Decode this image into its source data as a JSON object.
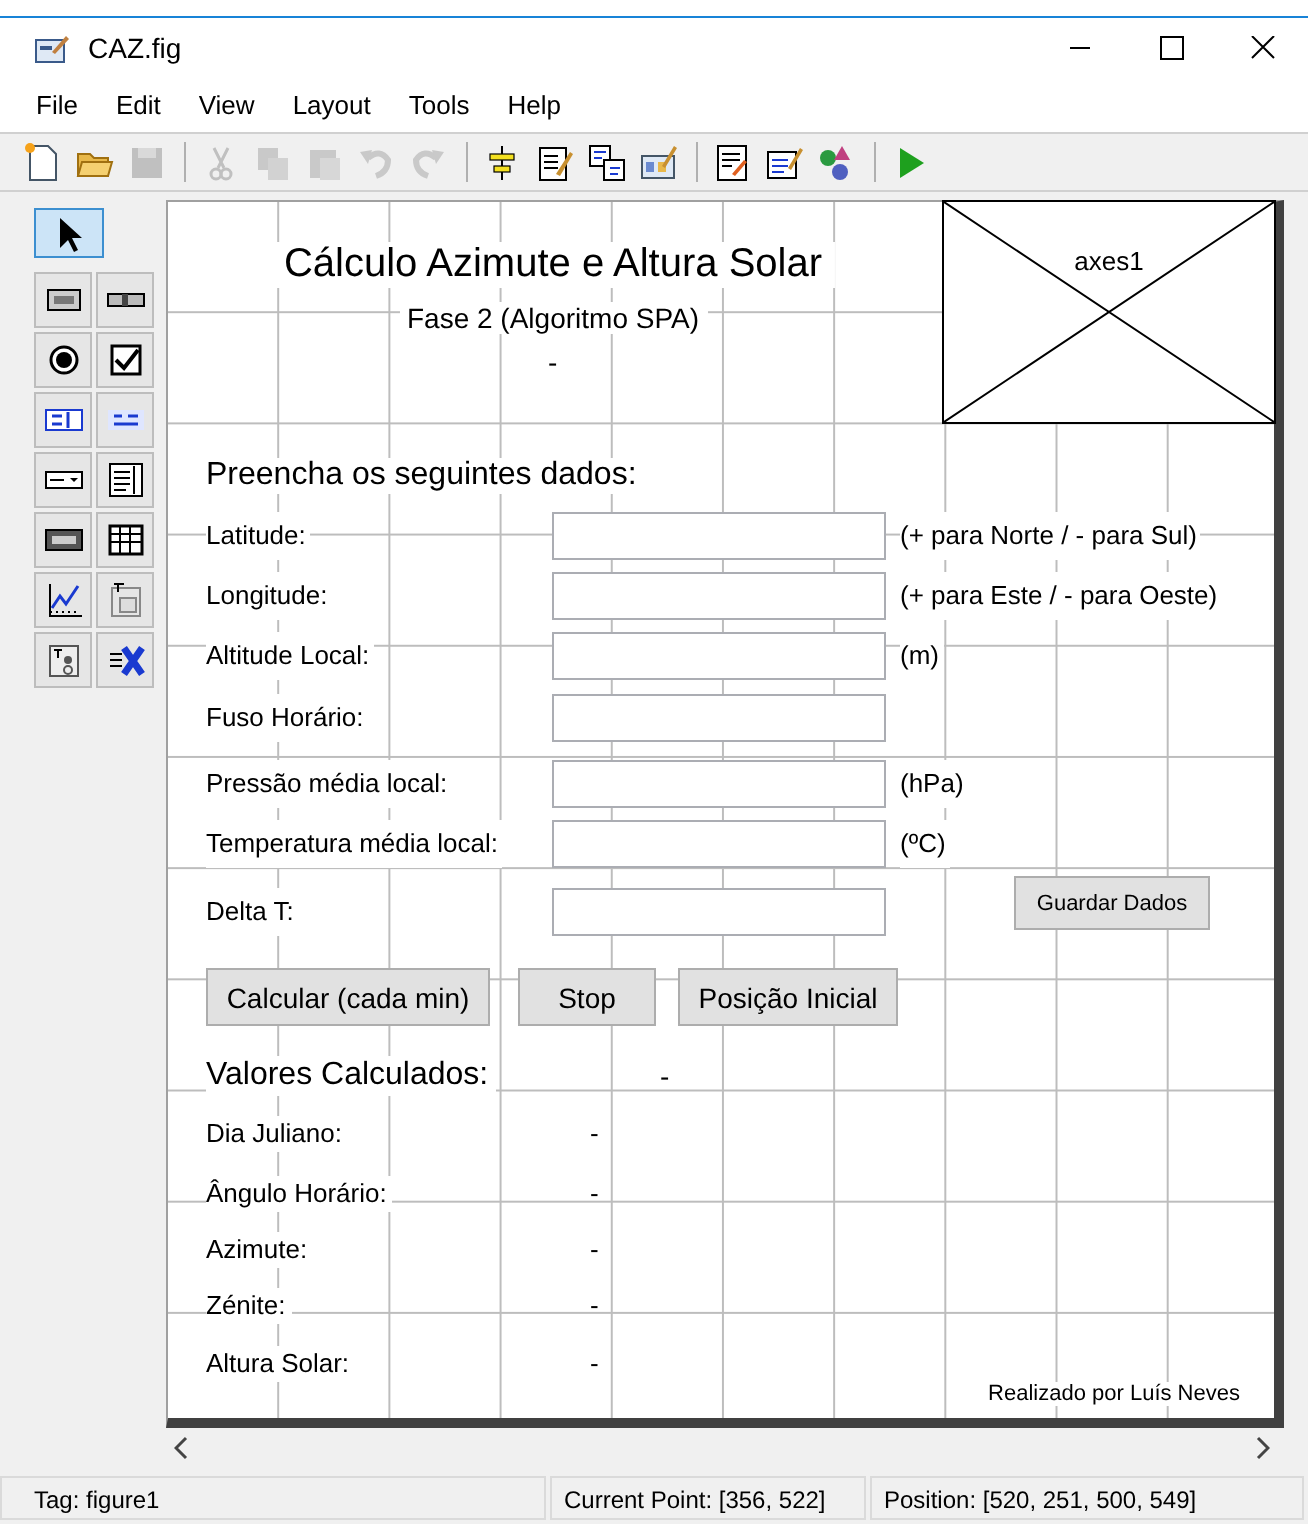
{
  "window": {
    "title": "CAZ.fig"
  },
  "menu": [
    "File",
    "Edit",
    "View",
    "Layout",
    "Tools",
    "Help"
  ],
  "toolbar": [
    {
      "kind": "new",
      "disabled": false
    },
    {
      "kind": "open",
      "disabled": false
    },
    {
      "kind": "save",
      "disabled": true
    },
    {
      "kind": "separator"
    },
    {
      "kind": "cut",
      "disabled": true
    },
    {
      "kind": "copy",
      "disabled": true
    },
    {
      "kind": "paste",
      "disabled": true
    },
    {
      "kind": "undo",
      "disabled": true
    },
    {
      "kind": "redo",
      "disabled": true
    },
    {
      "kind": "separator"
    },
    {
      "kind": "align",
      "disabled": false
    },
    {
      "kind": "menu-editor",
      "disabled": false
    },
    {
      "kind": "tab-order",
      "disabled": false
    },
    {
      "kind": "toolbar-editor",
      "disabled": false
    },
    {
      "kind": "separator"
    },
    {
      "kind": "editor",
      "disabled": false
    },
    {
      "kind": "inspector",
      "disabled": false
    },
    {
      "kind": "browser",
      "disabled": false
    },
    {
      "kind": "separator"
    },
    {
      "kind": "run",
      "disabled": false
    }
  ],
  "palette": [
    {
      "kind": "pointer",
      "selected": true
    },
    {
      "kind": "push-button",
      "selected": false
    },
    {
      "kind": "slider",
      "selected": false
    },
    {
      "kind": "radio",
      "selected": false
    },
    {
      "kind": "checkbox",
      "selected": false
    },
    {
      "kind": "edit",
      "selected": false
    },
    {
      "kind": "static",
      "selected": false
    },
    {
      "kind": "popup",
      "selected": false
    },
    {
      "kind": "listbox",
      "selected": false
    },
    {
      "kind": "toggle",
      "selected": false
    },
    {
      "kind": "table",
      "selected": false
    },
    {
      "kind": "axes",
      "selected": false
    },
    {
      "kind": "panel",
      "selected": false
    },
    {
      "kind": "button-group",
      "selected": false
    },
    {
      "kind": "activex",
      "selected": false
    }
  ],
  "canvas": {
    "title": "Cálculo Azimute e Altura Solar",
    "subtitle": "Fase 2 (Algoritmo SPA)",
    "status_text": "-",
    "axes_label": "axes1",
    "prompt": "Preencha os seguintes dados:",
    "inputs": [
      {
        "label": "Latitude:",
        "unit": "(+ para Norte / - para Sul)"
      },
      {
        "label": "Longitude:",
        "unit": "(+ para Este / - para Oeste)"
      },
      {
        "label": "Altitude Local:",
        "unit": "(m)"
      },
      {
        "label": "Fuso Horário:"
      },
      {
        "label": "Pressão média local:",
        "unit": "(hPa)"
      },
      {
        "label": "Temperatura média local:",
        "unit": "(ºC)"
      },
      {
        "label": "Delta T:"
      }
    ],
    "save_button": "Guardar Dados",
    "buttons": [
      "Calcular (cada min)",
      "Stop",
      "Posição Inicial"
    ],
    "results_heading": "Valores Calculados:",
    "results_heading_value": "-",
    "results": [
      {
        "label": "Dia Juliano:",
        "value": "-"
      },
      {
        "label": "Ângulo Horário:",
        "value": "-"
      },
      {
        "label": "Azimute:",
        "value": "-"
      },
      {
        "label": "Zénite:",
        "value": "-"
      },
      {
        "label": "Altura Solar:",
        "value": "-"
      }
    ],
    "credit": "Realizado por Luís Neves"
  },
  "status_bar": {
    "tag": "Tag: figure1",
    "current_point": "Current Point:  [356, 522]",
    "position": "Position: [520, 251, 500, 549]"
  }
}
